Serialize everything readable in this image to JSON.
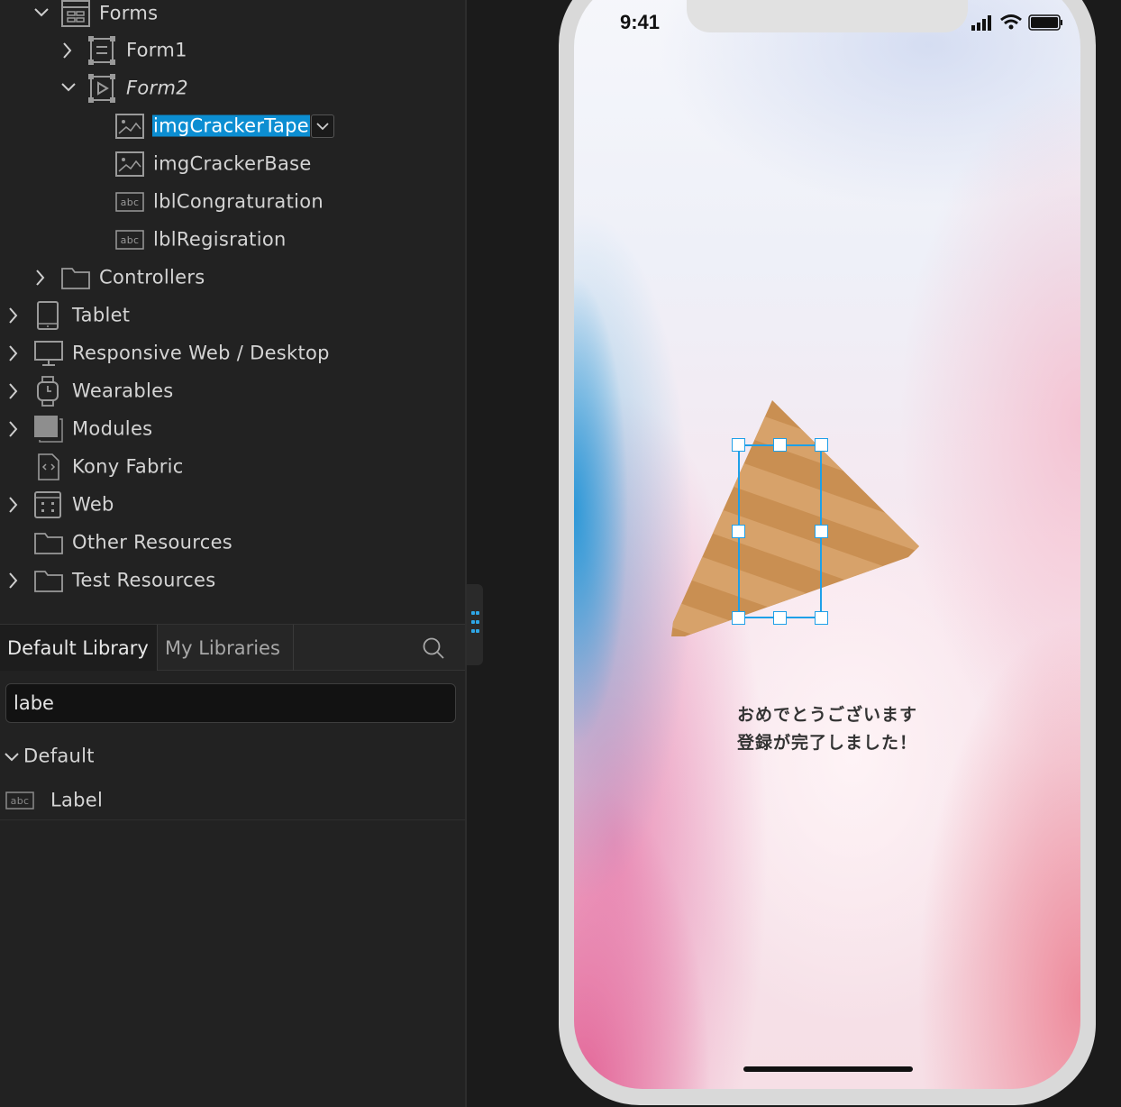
{
  "tree": {
    "forms": {
      "label": "Forms"
    },
    "form1": {
      "label": "Form1"
    },
    "form2": {
      "label": "Form2"
    },
    "widgets": [
      {
        "label": "imgCrackerTape",
        "icon": "image-icon"
      },
      {
        "label": "imgCrackerBase",
        "icon": "image-icon"
      },
      {
        "label": "lblCongraturation",
        "icon": "label-abc-icon"
      },
      {
        "label": "lblRegisration",
        "icon": "label-abc-icon"
      }
    ],
    "controllers": {
      "label": "Controllers"
    },
    "channels": [
      {
        "label": "Tablet",
        "icon": "tablet-icon"
      },
      {
        "label": "Responsive Web / Desktop",
        "icon": "desktop-icon"
      },
      {
        "label": "Wearables",
        "icon": "watch-icon"
      },
      {
        "label": "Modules",
        "icon": "module-icon"
      },
      {
        "label": "Kony Fabric",
        "icon": "code-file-icon"
      },
      {
        "label": "Web",
        "icon": "web-grid-icon"
      },
      {
        "label": "Other Resources",
        "icon": "folder-icon"
      },
      {
        "label": "Test Resources",
        "icon": "folder-icon"
      }
    ]
  },
  "library": {
    "tabs": [
      "Default Library",
      "My Libraries"
    ],
    "search_value": "labe",
    "group": "Default",
    "items": [
      {
        "label": "Label",
        "icon": "label-abc-icon"
      }
    ]
  },
  "phone": {
    "time": "9:41",
    "message_line1": "おめでとうございます",
    "message_line2": "登録が完了しました！"
  },
  "colors": {
    "selection": "#0c8ed2",
    "handle": "#1ea0e8",
    "panel": "#222222",
    "cracker": "#c98f52"
  }
}
